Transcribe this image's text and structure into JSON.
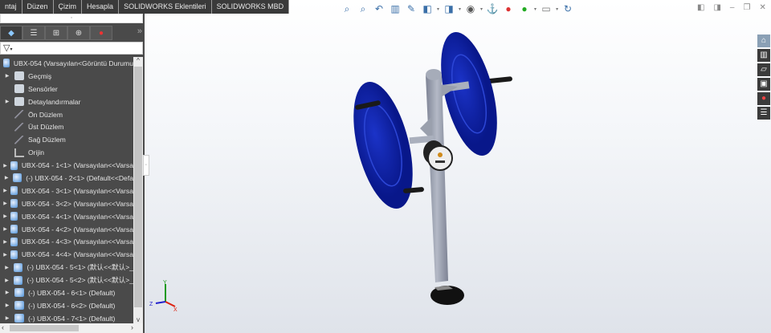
{
  "menu": [
    "ntaj",
    "Düzen",
    "Çizim",
    "Hesapla",
    "SOLIDWORKS Eklentileri",
    "SOLIDWORKS MBD"
  ],
  "panel": {
    "grip": "◦",
    "more": "»",
    "filter_icon": "filter-icon"
  },
  "tree": {
    "root": "UBX-054  (Varsayılan<Görüntü Durumu",
    "items": [
      {
        "label": "Geçmiş",
        "icon": "history-folder",
        "expand": true
      },
      {
        "label": "Sensörler",
        "icon": "sensor",
        "expand": false
      },
      {
        "label": "Detaylandırmalar",
        "icon": "annotations",
        "expand": true
      },
      {
        "label": "Ön Düzlem",
        "icon": "plane",
        "expand": false
      },
      {
        "label": "Üst Düzlem",
        "icon": "plane",
        "expand": false
      },
      {
        "label": "Sağ Düzlem",
        "icon": "plane",
        "expand": false
      },
      {
        "label": "Orijin",
        "icon": "origin",
        "expand": false
      },
      {
        "label": "UBX-054 - 1<1> (Varsayılan<<Varsa",
        "icon": "part",
        "expand": true
      },
      {
        "label": "(-) UBX-054 - 2<1> (Default<<Defa",
        "icon": "part",
        "expand": true
      },
      {
        "label": "UBX-054 - 3<1> (Varsayılan<<Varsa",
        "icon": "part",
        "expand": true
      },
      {
        "label": "UBX-054 - 3<2> (Varsayılan<<Varsa",
        "icon": "part",
        "expand": true
      },
      {
        "label": "UBX-054 - 4<1> (Varsayılan<<Varsa",
        "icon": "part",
        "expand": true
      },
      {
        "label": "UBX-054 - 4<2> (Varsayılan<<Varsa",
        "icon": "part",
        "expand": true
      },
      {
        "label": "UBX-054 - 4<3> (Varsayılan<<Varsa",
        "icon": "part",
        "expand": true
      },
      {
        "label": "UBX-054 - 4<4> (Varsayılan<<Varsa",
        "icon": "part",
        "expand": true
      },
      {
        "label": "(-) UBX-054 - 5<1> (默认<<默认>_",
        "icon": "part",
        "expand": true
      },
      {
        "label": "(-) UBX-054 - 5<2> (默认<<默认>_",
        "icon": "part",
        "expand": true
      },
      {
        "label": "(-) UBX-054 - 6<1> (Default)",
        "icon": "part",
        "expand": true
      },
      {
        "label": "(-) UBX-054 - 6<2> (Default)",
        "icon": "part",
        "expand": true
      },
      {
        "label": "(-) UBX-054 - 7<1> (Default)",
        "icon": "part",
        "expand": true
      }
    ]
  },
  "triad": {
    "x": "X",
    "y": "Y",
    "z": "Z"
  },
  "colors": {
    "disc": "#0a1fa0",
    "pole": "#9aa0b0",
    "accent": "#3a6fa8"
  }
}
